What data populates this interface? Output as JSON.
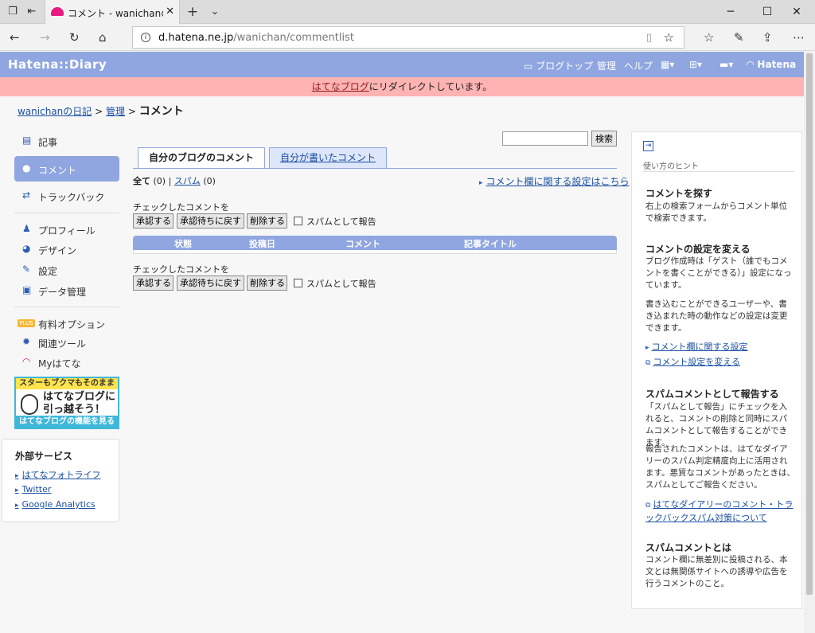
{
  "browser": {
    "tab_title": "コメント - wanichanの日記",
    "url_host": "d.hatena.ne.jp",
    "url_path": "/wanichan/commentlist"
  },
  "header": {
    "logo": "Hatena::Diary",
    "nav_blog_top": "ブログトップ",
    "nav_admin": "管理",
    "nav_help": "ヘルプ",
    "nav_hatena": "Hatena"
  },
  "redirect": {
    "link": "はてなブログ",
    "text": "にリダイレクトしています。"
  },
  "breadcrumb": {
    "diary": "wanichanの日記",
    "sep1": ">",
    "admin": "管理",
    "sep2": ">",
    "current": "コメント"
  },
  "sidebar": {
    "items": [
      {
        "label": "記事",
        "icon": "document-icon"
      },
      {
        "label": "コメント",
        "icon": "speech-bubble-icon"
      },
      {
        "label": "トラックバック",
        "icon": "arrows-icon"
      },
      {
        "label": "プロフィール",
        "icon": "person-icon"
      },
      {
        "label": "デザイン",
        "icon": "palette-icon"
      },
      {
        "label": "設定",
        "icon": "wrench-icon"
      },
      {
        "label": "データ管理",
        "icon": "database-icon"
      },
      {
        "label": "有料オプション",
        "icon": "plus-badge-icon",
        "badge": "PLUS"
      },
      {
        "label": "関連ツール",
        "icon": "gear-icon"
      },
      {
        "label": "Myはてな",
        "icon": "hatena-icon"
      }
    ],
    "banner": {
      "top": "スターもブクマもそのまま",
      "mid1": "はてなブログに",
      "mid2": "引っ越そう！",
      "bottom": "はてなブログの機能を見る"
    },
    "external": {
      "title": "外部サービス",
      "links": [
        "はてなフォトライフ",
        "Twitter",
        "Google Analytics"
      ]
    }
  },
  "search": {
    "button": "検索",
    "value": ""
  },
  "tabs": {
    "mine": "自分のブログのコメント",
    "wrote": "自分が書いたコメント"
  },
  "filter": {
    "all_label": "全て",
    "all_count": "(0)",
    "sep": "|",
    "spam_label": "スパム",
    "spam_count": "(0)"
  },
  "setting_link": "コメント欄に関する設定はこちら",
  "actions": {
    "caption": "チェックしたコメントを",
    "approve": "承認する",
    "pending": "承認待ちに戻す",
    "delete": "削除する",
    "spam_report": "スパムとして報告"
  },
  "table": {
    "columns": [
      "状態",
      "投稿日",
      "コメント",
      "記事タイトル"
    ]
  },
  "hints": {
    "title": "使い方のヒント",
    "sections": [
      {
        "heading": "コメントを探す",
        "body": "右上の検索フォームからコメント単位で検索できます。"
      },
      {
        "heading": "コメントの設定を変える",
        "body": "ブログ作成時は「ゲスト（誰でもコメントを書くことができる）」設定になっています。",
        "body2": "書き込むことができるユーザーや、書き込まれた時の動作などの設定は変更できます。",
        "link1": "コメント欄に関する設定",
        "link2": "コメント設定を変える"
      },
      {
        "heading": "スパムコメントとして報告する",
        "body": "「スパムとして報告」にチェックを入れると、コメントの削除と同時にスパムコメントとして報告することができます。",
        "body2": "報告されたコメントは、はてなダイアリーのスパム判定精度向上に活用されます。悪質なコメントがあったときは、スパムとしてご報告ください。",
        "link1": "はてなダイアリーのコメント・トラックバックスパム対策について"
      },
      {
        "heading": "スパムコメントとは",
        "body": "コメント欄に無差別に投稿される、本文とは無関係サイトへの誘導や広告を行うコメントのこと。"
      }
    ]
  }
}
